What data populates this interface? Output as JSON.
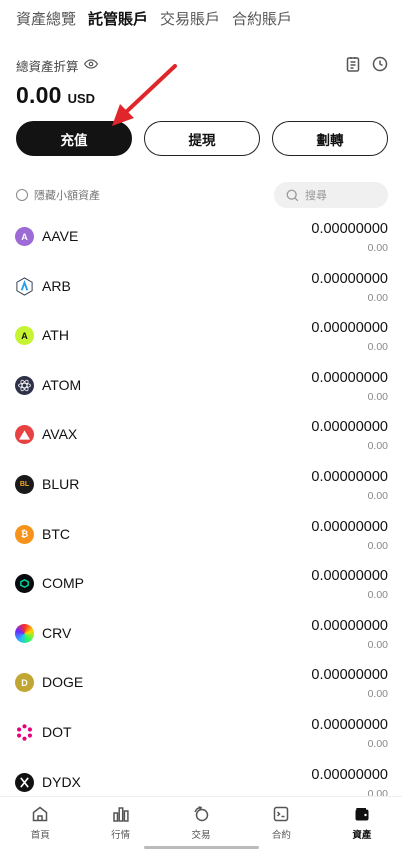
{
  "tabs": [
    {
      "label": "資產總覽",
      "active": false
    },
    {
      "label": "託管賬戶",
      "active": true
    },
    {
      "label": "交易賬戶",
      "active": false
    },
    {
      "label": "合約賬戶",
      "active": false
    }
  ],
  "balance": {
    "label": "總資產折算",
    "amount": "0.00",
    "currency": "USD"
  },
  "actions": {
    "deposit": "充值",
    "withdraw": "提現",
    "transfer": "劃轉"
  },
  "filter": {
    "hide_small_label": "隱藏小額資產",
    "search_placeholder": "搜尋"
  },
  "assets": [
    {
      "symbol": "AAVE",
      "qty": "0.00000000",
      "value": "0.00",
      "icon": "aave-icon",
      "color": "#9c6bd6"
    },
    {
      "symbol": "ARB",
      "qty": "0.00000000",
      "value": "0.00",
      "icon": "arb-icon",
      "color": "#2d374b"
    },
    {
      "symbol": "ATH",
      "qty": "0.00000000",
      "value": "0.00",
      "icon": "ath-icon",
      "color": "#c6f432"
    },
    {
      "symbol": "ATOM",
      "qty": "0.00000000",
      "value": "0.00",
      "icon": "atom-icon",
      "color": "#2e3148"
    },
    {
      "symbol": "AVAX",
      "qty": "0.00000000",
      "value": "0.00",
      "icon": "avax-icon",
      "color": "#e84142"
    },
    {
      "symbol": "BLUR",
      "qty": "0.00000000",
      "value": "0.00",
      "icon": "blur-icon",
      "color": "#1a1a1a"
    },
    {
      "symbol": "BTC",
      "qty": "0.00000000",
      "value": "0.00",
      "icon": "btc-icon",
      "color": "#f7931a"
    },
    {
      "symbol": "COMP",
      "qty": "0.00000000",
      "value": "0.00",
      "icon": "comp-icon",
      "color": "#070a0e"
    },
    {
      "symbol": "CRV",
      "qty": "0.00000000",
      "value": "0.00",
      "icon": "crv-icon",
      "color": "#40649f"
    },
    {
      "symbol": "DOGE",
      "qty": "0.00000000",
      "value": "0.00",
      "icon": "doge-icon",
      "color": "#c2a633"
    },
    {
      "symbol": "DOT",
      "qty": "0.00000000",
      "value": "0.00",
      "icon": "dot-icon",
      "color": "#e6007a"
    },
    {
      "symbol": "DYDX",
      "qty": "0.00000000",
      "value": "0.00",
      "icon": "dydx-icon",
      "color": "#111111"
    }
  ],
  "nav": [
    {
      "label": "首頁",
      "icon": "home-icon",
      "active": false
    },
    {
      "label": "行情",
      "icon": "market-chart-icon",
      "active": false
    },
    {
      "label": "交易",
      "icon": "trade-icon",
      "active": false
    },
    {
      "label": "合約",
      "icon": "contract-icon",
      "active": false
    },
    {
      "label": "資產",
      "icon": "wallet-icon",
      "active": true
    }
  ],
  "colors": {
    "primary_button": "#131313",
    "arrow_annotation": "#e0262b"
  }
}
